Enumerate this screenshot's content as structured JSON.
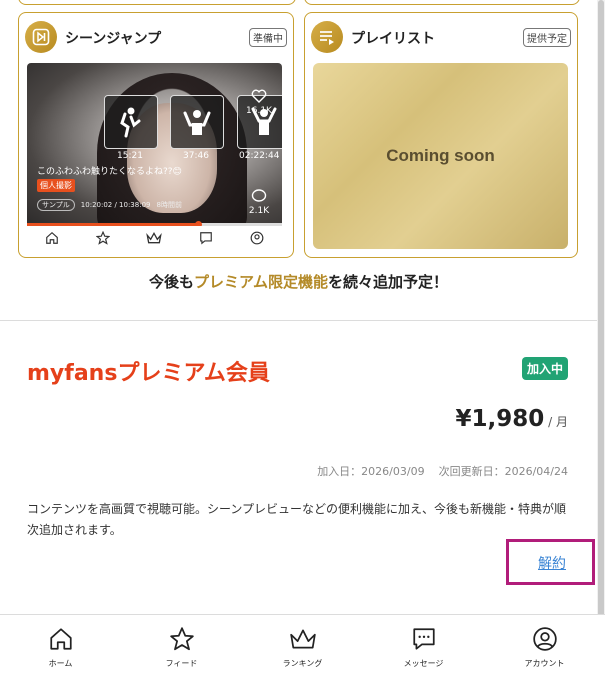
{
  "feature_cards": [
    {
      "title": "シーンジャンプ",
      "badge": "準備中",
      "icon": "scene-jump-icon"
    },
    {
      "title": "プレイリスト",
      "badge": "提供予定",
      "icon": "playlist-icon"
    }
  ],
  "preview": {
    "scene_times": [
      "15:21",
      "37:46",
      "02:22:44"
    ],
    "likes": "16.1K",
    "comments": "2.1K",
    "caption": "このふわふわ触りたくなるよね??😊",
    "tag": "個人撮影",
    "sample_label": "サンプル",
    "duration": "10:20:02 / 10:38:09",
    "posted": "8時間前",
    "progress": 0.67
  },
  "coming_soon": "Coming soon",
  "note": {
    "prefix": "今後も",
    "highlight": "プレミアム限定機能",
    "suffix": "を続々追加予定！"
  },
  "plan": {
    "title": "myfansプレミアム会員",
    "status": "加入中",
    "price": "¥1,980",
    "per": " / 月",
    "joined_label": "加入日：2026/03/09",
    "renew_label": "次回更新日：2026/04/24",
    "description": "コンテンツを高画質で視聴可能。シーンプレビューなどの便利機能に加え、今後も新機能・特典が順次追加されます。",
    "cancel": "解約"
  },
  "tabs": [
    {
      "label": "ホーム",
      "icon": "home-icon"
    },
    {
      "label": "フィード",
      "icon": "star-icon"
    },
    {
      "label": "ランキング",
      "icon": "crown-icon"
    },
    {
      "label": "メッセージ",
      "icon": "message-icon"
    },
    {
      "label": "アカウント",
      "icon": "account-icon"
    }
  ],
  "colors": {
    "accent_gold": "#c8a030",
    "plan_red": "#e5401a",
    "joined_green": "#21a374",
    "link_blue": "#3a84d4",
    "highlight_box": "#b11d7a"
  }
}
